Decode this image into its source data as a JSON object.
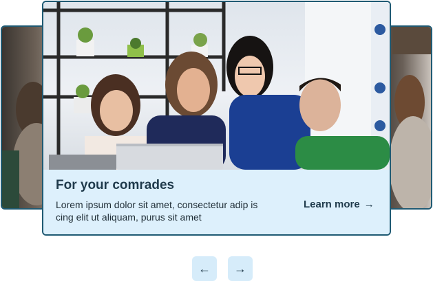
{
  "carousel": {
    "slide": {
      "title": "For your comrades",
      "description": "Lorem ipsum dolor sit amet, consectetur adip is cing elit ut aliquam, purus sit amet",
      "link_label": "Learn more",
      "link_icon": "arrow-right-icon",
      "image_alt": "four people smiling at a laptop"
    },
    "controls": {
      "prev_icon": "arrow-left-icon",
      "next_icon": "arrow-right-icon",
      "prev_glyph": "←",
      "next_glyph": "→",
      "link_glyph": "→"
    },
    "colors": {
      "border": "#1f5a73",
      "caption_bg": "#ddf0fc",
      "button_bg": "#d6ecfa",
      "text_dark": "#1f3a4b"
    }
  }
}
